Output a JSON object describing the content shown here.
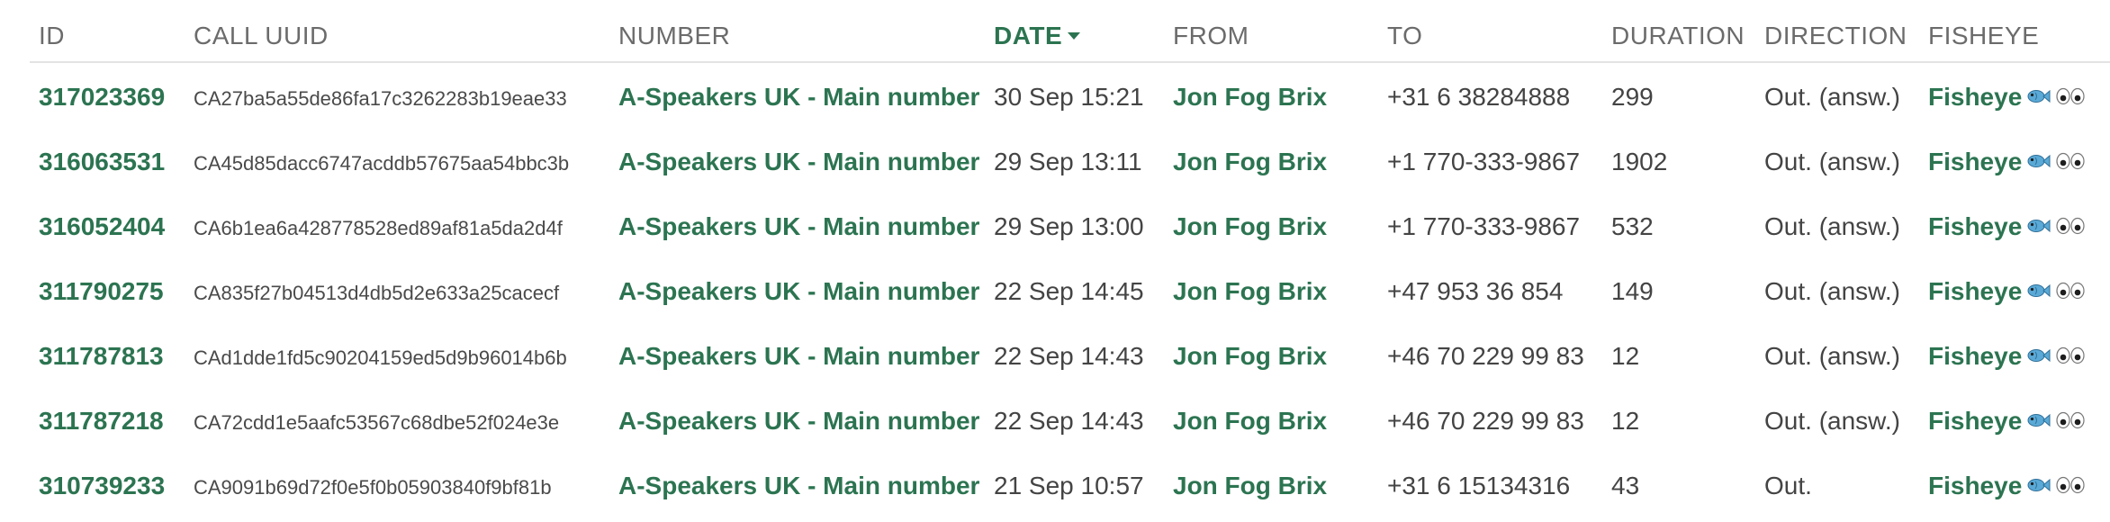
{
  "columns": {
    "id": "ID",
    "call_uuid": "CALL UUID",
    "number": "NUMBER",
    "date": "DATE",
    "from": "FROM",
    "to": "TO",
    "duration": "DURATION",
    "direction": "DIRECTION",
    "fisheye": "FISHEYE"
  },
  "sort": {
    "column": "date",
    "direction": "desc",
    "icon": "caret-down-icon"
  },
  "colors": {
    "link": "#2c7451",
    "header": "#6b6b6b",
    "text": "#444444"
  },
  "rows": [
    {
      "id": "317023369",
      "call_uuid": "CA27ba5a55de86fa17c3262283b19eae33",
      "number": "A-Speakers UK - Main number",
      "date": "30 Sep 15:21",
      "from": "Jon Fog Brix",
      "to": "+31 6 38284888",
      "duration": "299",
      "direction": "Out. (answ.)",
      "fisheye": "Fisheye"
    },
    {
      "id": "316063531",
      "call_uuid": "CA45d85dacc6747acddb57675aa54bbc3b",
      "number": "A-Speakers UK - Main number",
      "date": "29 Sep 13:11",
      "from": "Jon Fog Brix",
      "to": "+1 770-333-9867",
      "duration": "1902",
      "direction": "Out. (answ.)",
      "fisheye": "Fisheye"
    },
    {
      "id": "316052404",
      "call_uuid": "CA6b1ea6a428778528ed89af81a5da2d4f",
      "number": "A-Speakers UK - Main number",
      "date": "29 Sep 13:00",
      "from": "Jon Fog Brix",
      "to": "+1 770-333-9867",
      "duration": "532",
      "direction": "Out. (answ.)",
      "fisheye": "Fisheye"
    },
    {
      "id": "311790275",
      "call_uuid": "CA835f27b04513d4db5d2e633a25cacecf",
      "number": "A-Speakers UK - Main number",
      "date": "22 Sep 14:45",
      "from": "Jon Fog Brix",
      "to": "+47 953 36 854",
      "duration": "149",
      "direction": "Out. (answ.)",
      "fisheye": "Fisheye"
    },
    {
      "id": "311787813",
      "call_uuid": "CAd1dde1fd5c90204159ed5d9b96014b6b",
      "number": "A-Speakers UK - Main number",
      "date": "22 Sep 14:43",
      "from": "Jon Fog Brix",
      "to": "+46 70 229 99 83",
      "duration": "12",
      "direction": "Out. (answ.)",
      "fisheye": "Fisheye"
    },
    {
      "id": "311787218",
      "call_uuid": "CA72cdd1e5aafc53567c68dbe52f024e3e",
      "number": "A-Speakers UK - Main number",
      "date": "22 Sep 14:43",
      "from": "Jon Fog Brix",
      "to": "+46 70 229 99 83",
      "duration": "12",
      "direction": "Out. (answ.)",
      "fisheye": "Fisheye"
    },
    {
      "id": "310739233",
      "call_uuid": "CA9091b69d72f0e5f0b05903840f9bf81b",
      "number": "A-Speakers UK - Main number",
      "date": "21 Sep 10:57",
      "from": "Jon Fog Brix",
      "to": "+31 6 15134316",
      "duration": "43",
      "direction": "Out.",
      "fisheye": "Fisheye"
    }
  ]
}
